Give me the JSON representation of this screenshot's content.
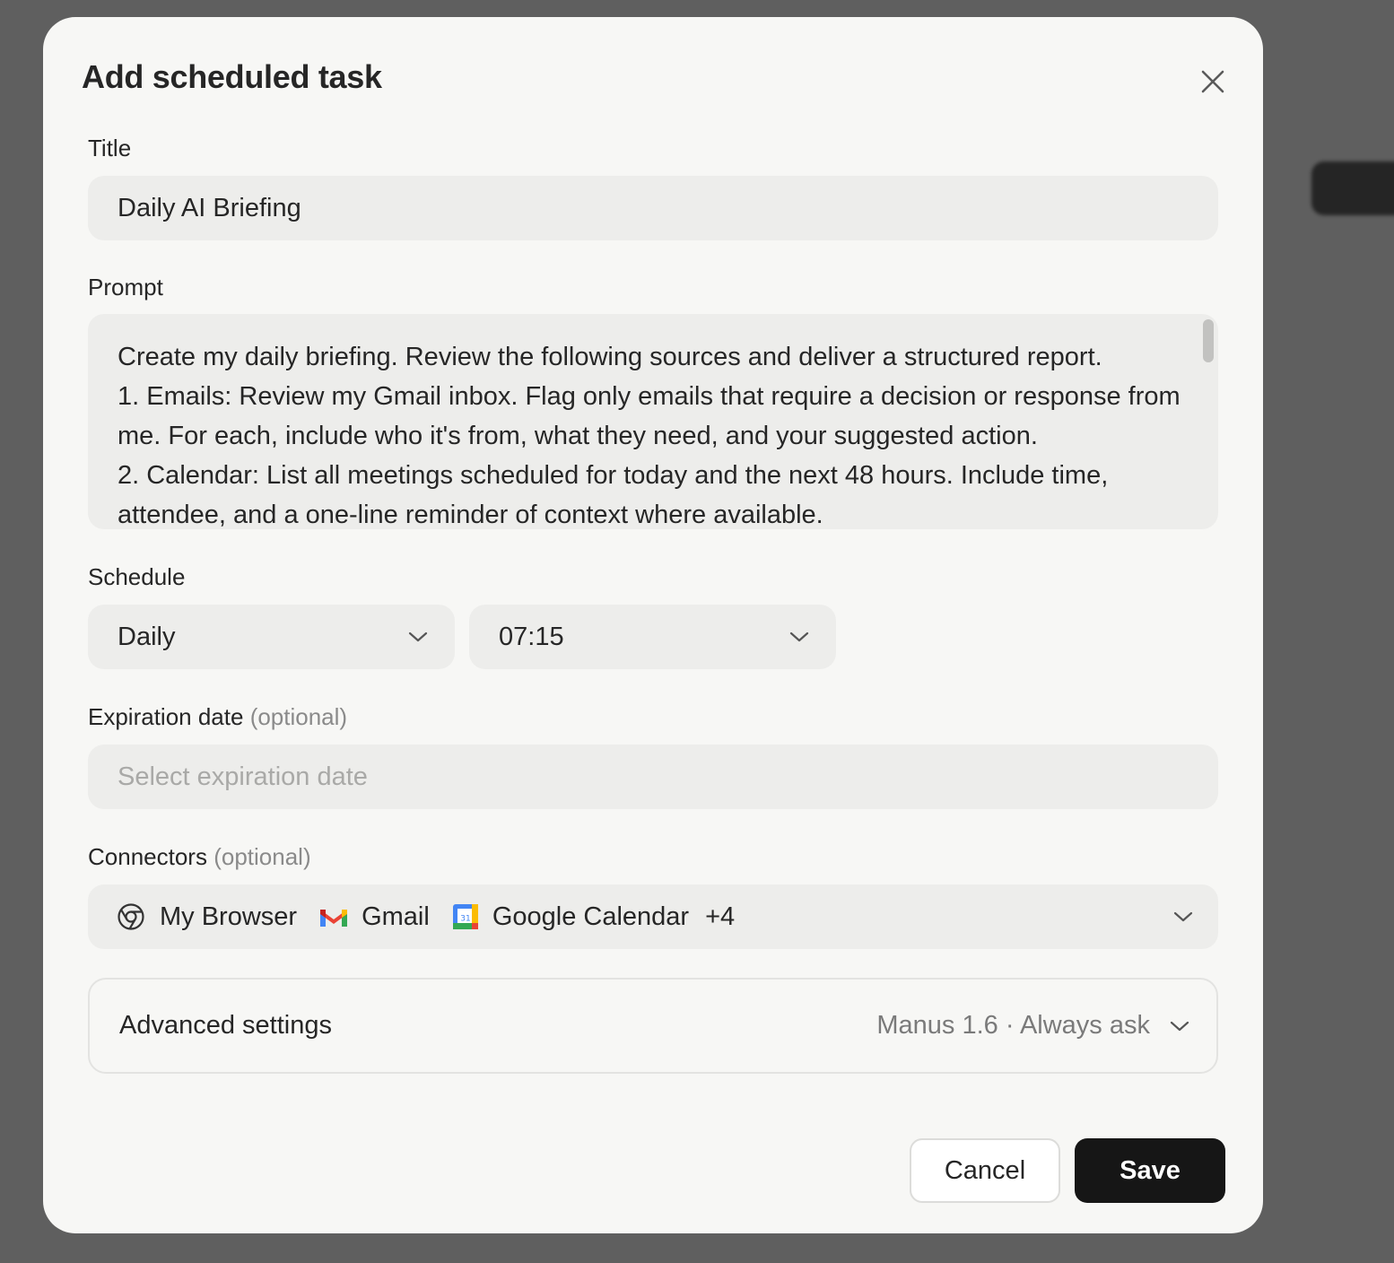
{
  "dialog": {
    "title": "Add scheduled task",
    "close_icon": "close-icon"
  },
  "title_field": {
    "label": "Title",
    "value": "Daily AI Briefing"
  },
  "prompt_field": {
    "label": "Prompt",
    "lines": [
      "Create my daily briefing. Review the following sources and deliver a structured report.",
      "1. Emails: Review my Gmail inbox. Flag only emails that require a decision or response from",
      "me. For each, include who it's from, what they need, and your suggested action.",
      "2. Calendar: List all meetings scheduled for today and the next 48 hours. Include time,",
      "attendee, and a one-line reminder of context where available."
    ]
  },
  "schedule": {
    "label": "Schedule",
    "frequency": "Daily",
    "time": "07:15"
  },
  "expiration": {
    "label": "Expiration date",
    "optional_suffix": "(optional)",
    "placeholder": "Select expiration date"
  },
  "connectors": {
    "label": "Connectors",
    "optional_suffix": "(optional)",
    "items": [
      {
        "label": "My Browser",
        "icon": "chrome-icon"
      },
      {
        "label": "Gmail",
        "icon": "gmail-icon"
      },
      {
        "label": "Google Calendar",
        "icon": "google-calendar-icon"
      }
    ],
    "more": "+4"
  },
  "advanced": {
    "label": "Advanced settings",
    "summary": "Manus 1.6 · Always ask"
  },
  "buttons": {
    "cancel": "Cancel",
    "save": "Save"
  },
  "colors": {
    "modal_bg": "#f7f7f5",
    "field_bg": "#ededeb",
    "save_bg": "#161616",
    "muted_text": "#8a8a8a"
  }
}
